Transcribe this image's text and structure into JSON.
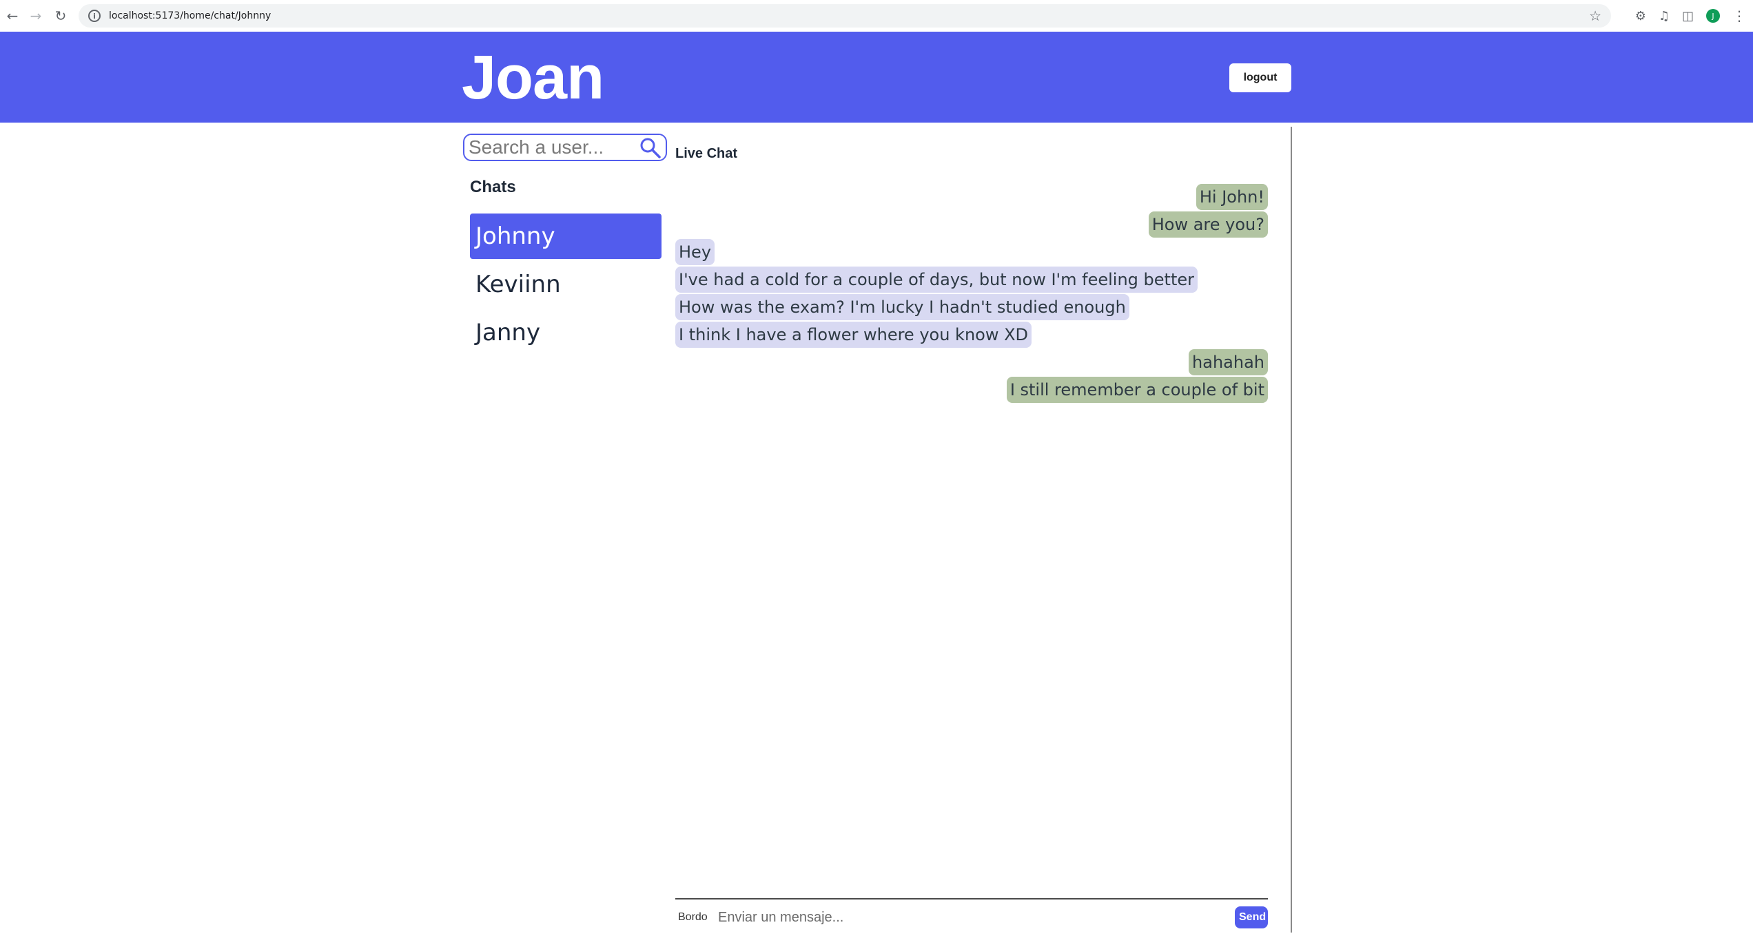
{
  "browser": {
    "url": "localhost:5173/home/chat/Johnny",
    "back_icon": "arrow-left-icon",
    "forward_icon": "arrow-right-icon",
    "reload_icon": "reload-icon",
    "profile_initial": "J"
  },
  "header": {
    "title": "Joan",
    "logout_label": "logout",
    "background_color": "#525ced"
  },
  "sidebar": {
    "search_placeholder": "Search a user...",
    "chats_heading": "Chats",
    "chats": [
      {
        "name": "Johnny",
        "active": true
      },
      {
        "name": "Keviinn",
        "active": false
      },
      {
        "name": "Janny",
        "active": false
      }
    ]
  },
  "chat": {
    "title": "Live Chat",
    "messages": [
      {
        "text": "Hi John!",
        "direction": "sent"
      },
      {
        "text": "How are you?",
        "direction": "sent"
      },
      {
        "text": "Hey",
        "direction": "received"
      },
      {
        "text": "I've had a cold for a couple of days, but now I'm feeling better",
        "direction": "received"
      },
      {
        "text": "How was the exam? I'm lucky I hadn't studied enough",
        "direction": "received"
      },
      {
        "text": "I think I have a flower where you know XD",
        "direction": "received"
      },
      {
        "text": "hahahah",
        "direction": "sent"
      },
      {
        "text": "I still remember a couple of bit",
        "direction": "sent"
      }
    ],
    "sent_color": "#b2c4a2",
    "received_color": "#d8d9f2"
  },
  "composer": {
    "label": "Bordo",
    "placeholder": "Enviar un mensaje...",
    "send_label": "Send"
  }
}
